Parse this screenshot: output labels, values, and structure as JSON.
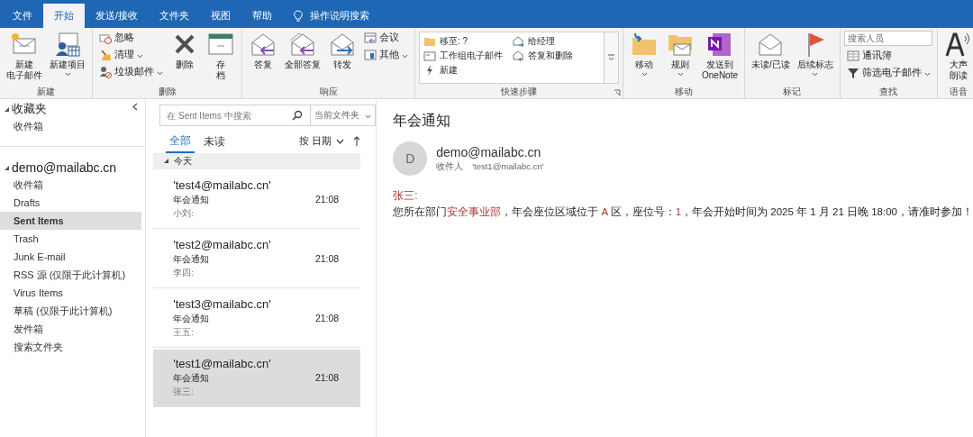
{
  "menu_tabs": [
    {
      "label": "文件",
      "selected": false
    },
    {
      "label": "开始",
      "selected": true
    },
    {
      "label": "发送/接收",
      "selected": false
    },
    {
      "label": "文件夹",
      "selected": false
    },
    {
      "label": "视图",
      "selected": false
    },
    {
      "label": "帮助",
      "selected": false
    }
  ],
  "tell_me": {
    "label": "操作说明搜索"
  },
  "ribbon": {
    "groups": [
      {
        "label": "新建",
        "items": [
          {
            "kind": "large",
            "label_lines": [
              "新建",
              "电子邮件"
            ],
            "dropdown": false
          },
          {
            "kind": "large",
            "label": "新建项目",
            "dropdown": true
          }
        ]
      },
      {
        "label": "删除",
        "items": [
          {
            "kind": "stack",
            "buttons": [
              {
                "kind": "small",
                "label": "忽略",
                "dropdown": false
              },
              {
                "kind": "small",
                "label": "清理",
                "dropdown": true
              },
              {
                "kind": "small",
                "label": "垃圾邮件",
                "dropdown": true
              }
            ]
          },
          {
            "kind": "large",
            "label": "删除",
            "dropdown": false
          },
          {
            "kind": "large",
            "label_lines": [
              "存",
              "档"
            ],
            "dropdown": false
          }
        ]
      },
      {
        "label": "响应",
        "items": [
          {
            "kind": "large",
            "label": "答复",
            "dropdown": false
          },
          {
            "kind": "large",
            "label": "全部答复",
            "dropdown": false
          },
          {
            "kind": "large",
            "label": "转发",
            "dropdown": false
          },
          {
            "kind": "stack",
            "buttons": [
              {
                "kind": "small",
                "label": "会议",
                "dropdown": false
              },
              {
                "kind": "small",
                "label": "其他",
                "dropdown": true
              }
            ]
          }
        ]
      },
      {
        "label": "快速步骤",
        "launcher": true,
        "items": [
          {
            "kind": "gallery",
            "entries": [
              "移至: ?",
              "工作组电子邮件",
              "新建",
              "给经理",
              "答复和删除"
            ]
          }
        ]
      },
      {
        "label": "移动",
        "items": [
          {
            "kind": "large",
            "label": "移动",
            "dropdown": true
          },
          {
            "kind": "large",
            "label": "规则",
            "dropdown": true
          },
          {
            "kind": "large",
            "label_lines": [
              "发送到",
              "OneNote"
            ],
            "dropdown": false
          }
        ]
      },
      {
        "label": "标记",
        "items": [
          {
            "kind": "large",
            "label": "未读/已读",
            "dropdown": false
          },
          {
            "kind": "large",
            "label": "后续标志",
            "dropdown": true
          }
        ]
      },
      {
        "label": "查找",
        "items": [
          {
            "kind": "stack",
            "buttons": [
              {
                "kind": "field",
                "placeholder": "搜索人员"
              },
              {
                "kind": "small",
                "label": "通讯簿",
                "dropdown": false
              },
              {
                "kind": "small",
                "label": "筛选电子邮件",
                "dropdown": true
              }
            ]
          }
        ]
      },
      {
        "label": "语音",
        "items": [
          {
            "kind": "large",
            "label_lines": [
              "大声",
              "朗读"
            ],
            "dropdown": false
          }
        ]
      }
    ]
  },
  "folder_pane": {
    "sections": [
      {
        "title": "收藏夹",
        "expanded": true,
        "items": [
          {
            "label": "收件箱",
            "selected": false
          }
        ]
      },
      {
        "title": "demo@mailabc.cn",
        "expanded": true,
        "items": [
          {
            "label": "收件箱",
            "selected": false
          },
          {
            "label": "Drafts",
            "selected": false
          },
          {
            "label": "Sent Items",
            "selected": true
          },
          {
            "label": "Trash",
            "selected": false
          },
          {
            "label": "Junk E-mail",
            "selected": false
          },
          {
            "label": "RSS 源 (仅限于此计算机)",
            "selected": false
          },
          {
            "label": "Virus Items",
            "selected": false
          },
          {
            "label": "草稿 (仅限于此计算机)",
            "selected": false
          },
          {
            "label": "发件箱",
            "selected": false
          },
          {
            "label": "搜索文件夹",
            "selected": false
          }
        ]
      }
    ]
  },
  "message_list": {
    "search": {
      "placeholder": "在 Sent Items 中搜索"
    },
    "scope": "当前文件夹",
    "filters": [
      {
        "label": "全部",
        "selected": true
      },
      {
        "label": "未读",
        "selected": false
      }
    ],
    "sort": "按 日期",
    "group": {
      "label": "今天",
      "expanded": true
    },
    "messages": [
      {
        "from": "'test4@mailabc.cn'",
        "subject": "年会通知",
        "time": "21:08",
        "preview": "小刘:",
        "selected": false
      },
      {
        "from": "'test2@mailabc.cn'",
        "subject": "年会通知",
        "time": "21:08",
        "preview": "李四:",
        "selected": false
      },
      {
        "from": "'test3@mailabc.cn'",
        "subject": "年会通知",
        "time": "21:08",
        "preview": "王五:",
        "selected": false
      },
      {
        "from": "'test1@mailabc.cn'",
        "subject": "年会通知",
        "time": "21:08",
        "preview": "张三:",
        "selected": true
      }
    ]
  },
  "reading_pane": {
    "subject": "年会通知",
    "avatar": "D",
    "sender": "demo@mailabc.cn",
    "to_label": "收件人",
    "to": "'test1@mailabc.cn'",
    "greeting": "张三:",
    "body": [
      {
        "text": "您所在部门",
        "highlight": false
      },
      {
        "text": "安全事业部",
        "highlight": true
      },
      {
        "text": "，年会座位区域位于 ",
        "highlight": false
      },
      {
        "text": "A",
        "highlight": true
      },
      {
        "text": " 区，座位号：",
        "highlight": false
      },
      {
        "text": "1",
        "highlight": true
      },
      {
        "text": "，年会开始时间为 2025 年 1 月 21 日晚 18:00，请准时参加！",
        "highlight": false
      }
    ]
  }
}
